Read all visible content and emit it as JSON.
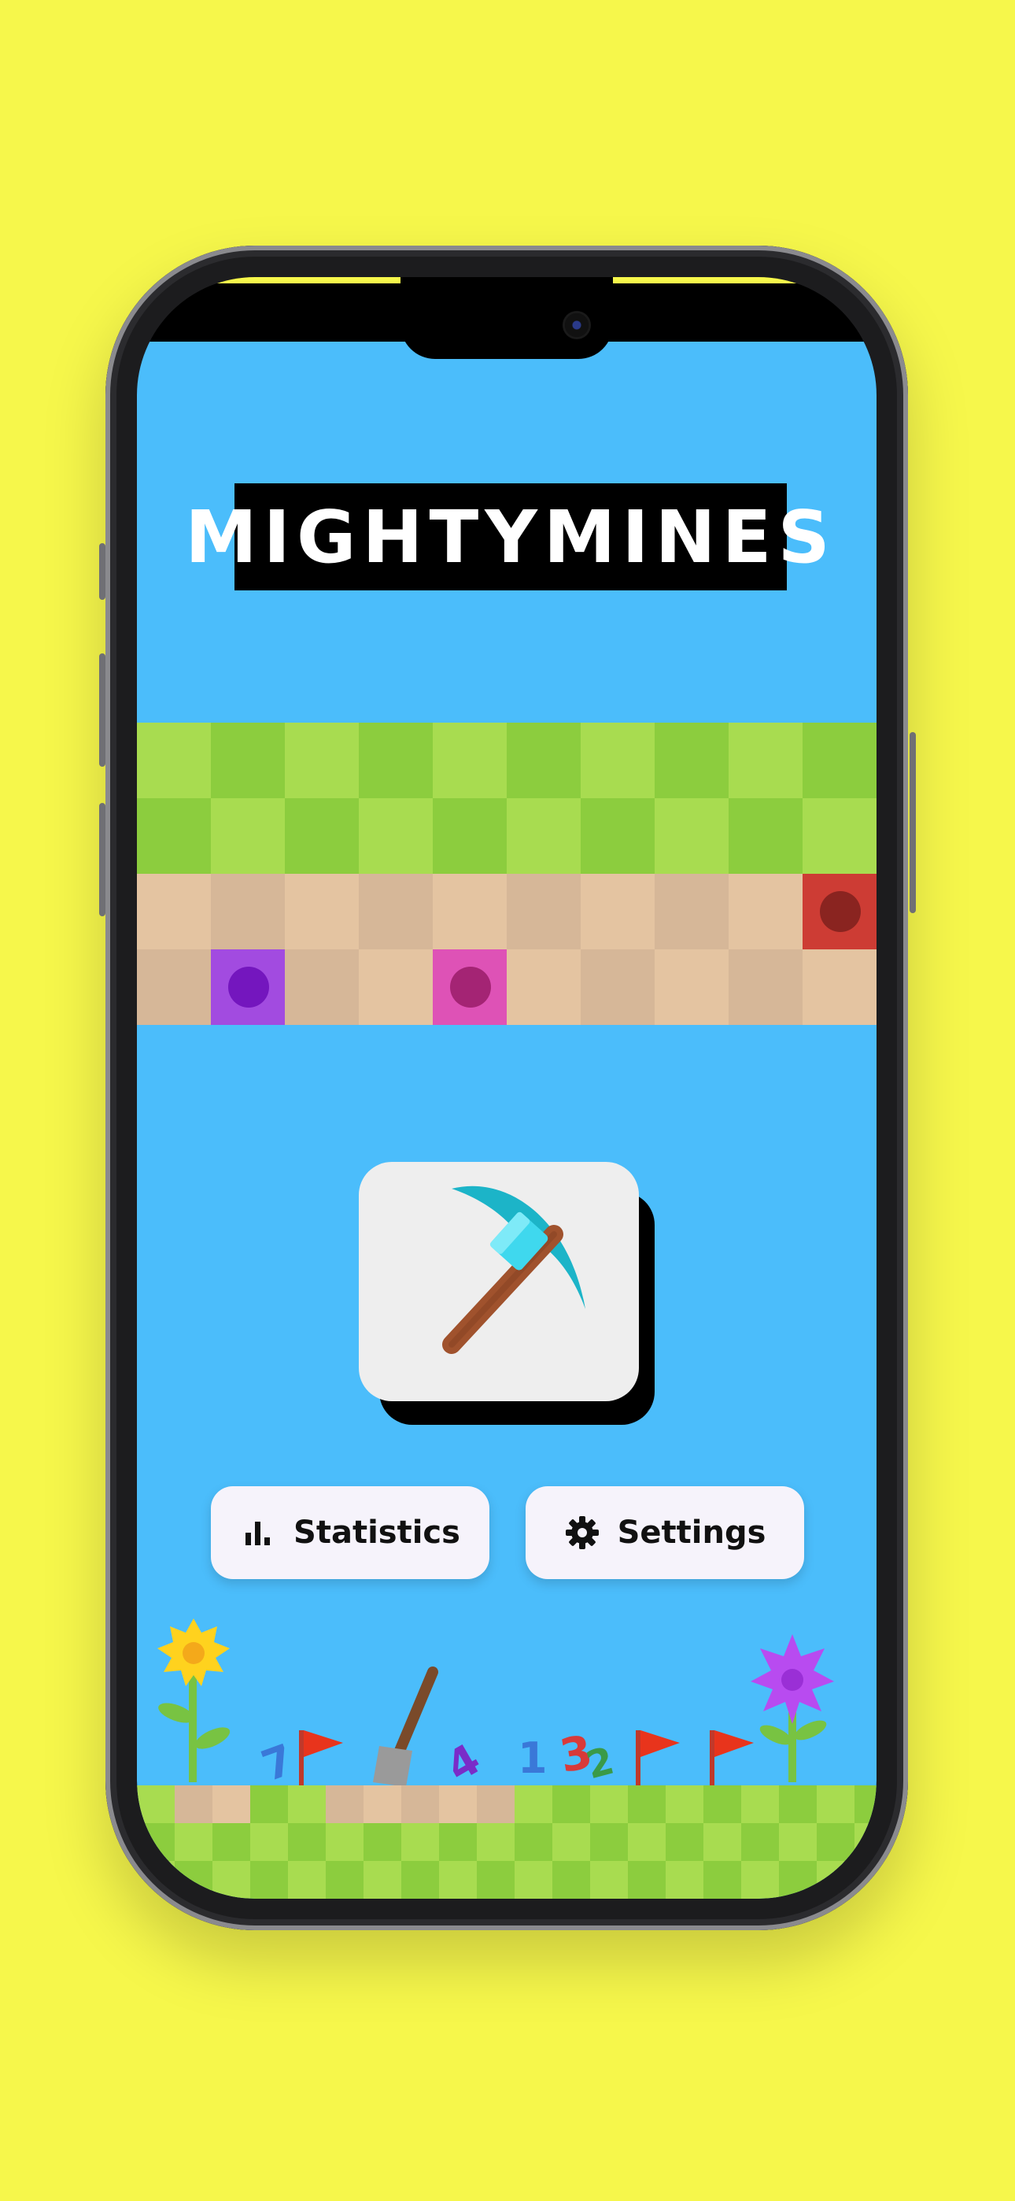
{
  "app": {
    "title": "MIGHTYMINES"
  },
  "buttons": {
    "statistics_label": "Statistics",
    "settings_label": "Settings"
  },
  "icons": {
    "statistics": "bar-chart-icon",
    "settings": "gear-icon",
    "logo": "pickaxe-icon"
  },
  "ground_numbers": [
    "7",
    "4",
    "1",
    "3",
    "2"
  ],
  "colors": {
    "background": "#f6f74b",
    "sky": "#4bbdfb",
    "grass_light": "#a8dc50",
    "grass_dark": "#8ccd3e",
    "dirt_light": "#e4c4a1",
    "dirt_dark": "#d6b798",
    "mine_red": "#cd3c34",
    "mine_purple": "#a24be0",
    "mine_pink": "#de52b6"
  }
}
